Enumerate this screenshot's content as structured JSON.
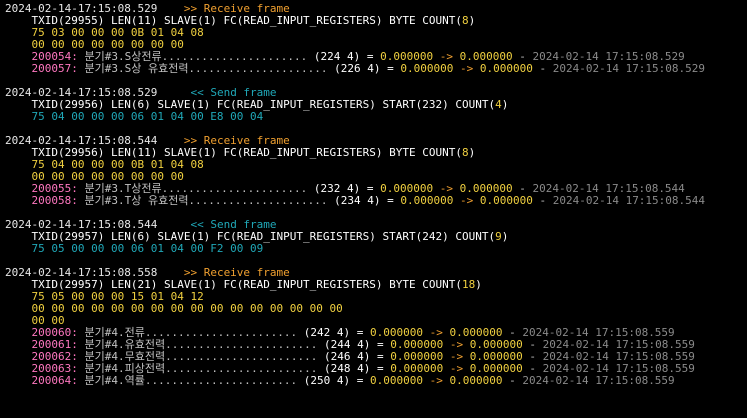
{
  "blocks": [
    {
      "type": "recv",
      "timestamp": "2024-02-14-17:15:08.529",
      "direction": ">> Receive frame",
      "header": "TXID(29955) LEN(11) SLAVE(1) FC(READ_INPUT_REGISTERS) BYTE COUNT(",
      "count": "8",
      "count_close": ")",
      "bytes": [
        "75 03 00 00 00 0B 01 04 08",
        "00 00 00 00 00 00 00 00"
      ],
      "registers": [
        {
          "id": "200054:",
          "name": "분기#3.S상전류......................",
          "addr": "(224 4) =",
          "value": "0.000000",
          "arrow": "->",
          "value2": "0.000000",
          "dash": "-",
          "time": "2024-02-14 17:15:08.529"
        },
        {
          "id": "200057:",
          "name": "분기#3.S상 유효전력.....................",
          "addr": "(226 4) =",
          "value": "0.000000",
          "arrow": "->",
          "value2": "0.000000",
          "dash": "-",
          "time": "2024-02-14 17:15:08.529"
        }
      ]
    },
    {
      "type": "send",
      "timestamp": "2024-02-14-17:15:08.529",
      "direction": "<< Send frame",
      "header": "TXID(29956) LEN(6) SLAVE(1) FC(READ_INPUT_REGISTERS) START(232) COUNT(",
      "count": "4",
      "count_close": ")",
      "bytes": [
        "75 04 00 00 00 06 01 04 00 E8 00 04"
      ],
      "registers": []
    },
    {
      "type": "recv",
      "timestamp": "2024-02-14-17:15:08.544",
      "direction": ">> Receive frame",
      "header": "TXID(29956) LEN(11) SLAVE(1) FC(READ_INPUT_REGISTERS) BYTE COUNT(",
      "count": "8",
      "count_close": ")",
      "bytes": [
        "75 04 00 00 00 0B 01 04 08",
        "00 00 00 00 00 00 00 00"
      ],
      "registers": [
        {
          "id": "200055:",
          "name": "분기#3.T상전류......................",
          "addr": "(232 4) =",
          "value": "0.000000",
          "arrow": "->",
          "value2": "0.000000",
          "dash": "-",
          "time": "2024-02-14 17:15:08.544"
        },
        {
          "id": "200058:",
          "name": "분기#3.T상 유효전력.....................",
          "addr": "(234 4) =",
          "value": "0.000000",
          "arrow": "->",
          "value2": "0.000000",
          "dash": "-",
          "time": "2024-02-14 17:15:08.544"
        }
      ]
    },
    {
      "type": "send",
      "timestamp": "2024-02-14-17:15:08.544",
      "direction": "<< Send frame",
      "header": "TXID(29957) LEN(6) SLAVE(1) FC(READ_INPUT_REGISTERS) START(242) COUNT(",
      "count": "9",
      "count_close": ")",
      "bytes": [
        "75 05 00 00 00 06 01 04 00 F2 00 09"
      ],
      "registers": []
    },
    {
      "type": "recv",
      "timestamp": "2024-02-14-17:15:08.558",
      "direction": ">> Receive frame",
      "header": "TXID(29957) LEN(21) SLAVE(1) FC(READ_INPUT_REGISTERS) BYTE COUNT(",
      "count": "18",
      "count_close": ")",
      "bytes": [
        "75 05 00 00 00 15 01 04 12",
        "00 00 00 00 00 00 00 00 00 00 00 00 00 00 00 00",
        "00 00"
      ],
      "registers": [
        {
          "id": "200060:",
          "name": "분기#4.전류.......................",
          "addr": "(242 4) =",
          "value": "0.000000",
          "arrow": "->",
          "value2": "0.000000",
          "dash": "-",
          "time": "2024-02-14 17:15:08.559"
        },
        {
          "id": "200061:",
          "name": "분기#4.유효전력.......................",
          "addr": "(244 4) =",
          "value": "0.000000",
          "arrow": "->",
          "value2": "0.000000",
          "dash": "-",
          "time": "2024-02-14 17:15:08.559"
        },
        {
          "id": "200062:",
          "name": "분기#4.무효전력.......................",
          "addr": "(246 4) =",
          "value": "0.000000",
          "arrow": "->",
          "value2": "0.000000",
          "dash": "-",
          "time": "2024-02-14 17:15:08.559"
        },
        {
          "id": "200063:",
          "name": "분기#4.피상전력.......................",
          "addr": "(248 4) =",
          "value": "0.000000",
          "arrow": "->",
          "value2": "0.000000",
          "dash": "-",
          "time": "2024-02-14 17:15:08.559"
        },
        {
          "id": "200064:",
          "name": "분기#4.역률.......................",
          "addr": "(250 4) =",
          "value": "0.000000",
          "arrow": "->",
          "value2": "0.000000",
          "dash": "-",
          "time": "2024-02-14 17:15:08.559"
        }
      ]
    }
  ]
}
